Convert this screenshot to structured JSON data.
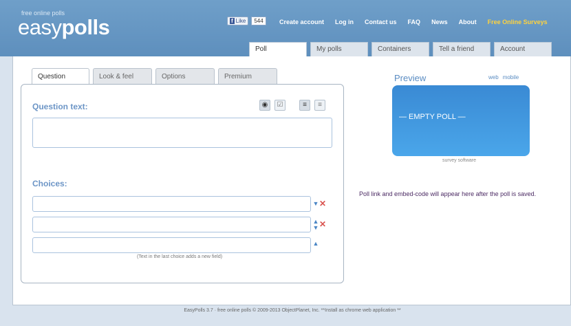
{
  "header": {
    "logo_tagline": "free online polls",
    "logo_part1": "easy",
    "logo_part2": "polls",
    "social": {
      "like_label": "Like",
      "count_label": "544"
    },
    "nav": [
      "Create account",
      "Log in",
      "Contact us",
      "FAQ",
      "News",
      "About"
    ],
    "nav_highlight": "Free Online Surveys",
    "highlight_color": "#ffd33d"
  },
  "page_tabs": [
    "Poll",
    "My polls",
    "Containers",
    "Tell a friend",
    "Account"
  ],
  "question_tabs": [
    "Question",
    "Look & feel",
    "Options",
    "Premium"
  ],
  "editor": {
    "question_text_label": "Question text:",
    "question_text_value": "",
    "tools": [
      "radio-icon",
      "checkbox-icon",
      "align-left-icon",
      "align-center-icon"
    ],
    "choices_label": "Choices:",
    "choices": [
      "",
      "",
      ""
    ],
    "hint": "(Text in the last choice adds a new field)"
  },
  "preview": {
    "title": "Preview",
    "link_web": "web",
    "link_mobile": "mobile",
    "empty_text": "— EMPTY POLL —",
    "credit": "survey software",
    "accent_color": "#3a8ad4"
  },
  "embed_note": "Poll link and embed-code will appear here after the poll is saved.",
  "footer": "EasyPolls 3.7  ·  free online polls  © 2009-2013 ObjectPlanet, Inc.     **Install as chrome web application **"
}
